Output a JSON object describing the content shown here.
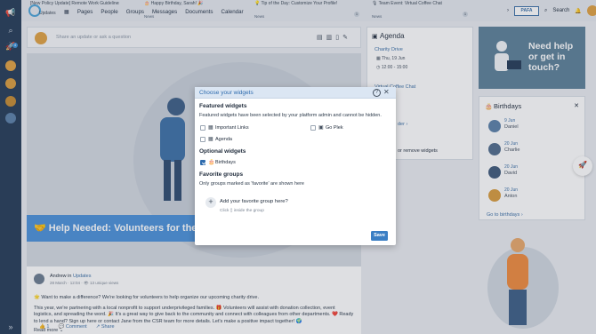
{
  "topbar": {
    "news": [
      {
        "title": "[New Policy Update] Remote Work Guidelines",
        "tag": "Updates",
        "count": ""
      },
      {
        "title": "🎂 Happy Birthday, Sarah! 🎉",
        "tag": "News",
        "count": "1"
      },
      {
        "title": "💡 Tip of the Day: Customize Your Profile!",
        "tag": "News",
        "count": "1"
      },
      {
        "title": "🎙 Team Event: Virtual Coffee Chat",
        "tag": "News",
        "count": "1"
      }
    ],
    "nav": [
      "Pages",
      "People",
      "Groups",
      "Messages",
      "Documents",
      "Calendar"
    ],
    "brand_short": "Updates",
    "search_label": "Search",
    "pill_logo": "PAFA"
  },
  "composer": {
    "placeholder": "Share an update or ask a question"
  },
  "post": {
    "hero_title": "🤝 Help Needed: Volunteers for the C",
    "author_line": "Andrew in",
    "author_group": "Updates",
    "date_line": "28 March · 12:04 · 👁 13 unique views",
    "body": [
      "🌟 Want to make a difference? We're looking for volunteers to help organize our upcoming charity drive.",
      "This year, we're partnering with a local nonprofit to support underprivileged families. 🎁 Volunteers will assist with donation collection, event logistics, and spreading the word. 🎉 It's a great way to give back to the community and connect with colleagues from other departments. ❤️ Ready to lend a hand? Sign up here or contact Jane from the CSR team for more details. Let's make a positive impact together! 🌍"
    ],
    "read_more": "Read more",
    "like_count": "1",
    "comment_label": "Comment",
    "share_label": "Share"
  },
  "agenda": {
    "title": "Agenda",
    "items": [
      {
        "name": "Charity Drive",
        "date": "Thu, 19 Jun",
        "time": "12:00 - 15:00"
      },
      {
        "name": "Virtual Coffee Chat",
        "date": "",
        "time": ""
      }
    ],
    "reorder_fragment": "der",
    "remove_fragment": "or remove widgets"
  },
  "help": {
    "text": "Need help or get in touch?"
  },
  "birthdays": {
    "title": "Birthdays",
    "people": [
      {
        "date": "9 Jun",
        "name": "Daniel"
      },
      {
        "date": "20 Jun",
        "name": "Charlie"
      },
      {
        "date": "20 Jun",
        "name": "David"
      },
      {
        "date": "20 Jun",
        "name": "Anton"
      }
    ],
    "goto": "Go to birthdays"
  },
  "rail": {
    "badge": "4"
  },
  "modal": {
    "title": "Choose your widgets",
    "featured_heading": "Featured widgets",
    "featured_desc": "Featured widgets have been selected by your platform admin and cannot be hidden.",
    "featured": [
      {
        "label": "Important Links",
        "checked": false
      },
      {
        "label": "Go Plek",
        "checked": false
      },
      {
        "label": "Agenda",
        "checked": false
      }
    ],
    "optional_heading": "Optional widgets",
    "optional": [
      {
        "label": "Birthdays",
        "checked": true
      }
    ],
    "fav_heading": "Favorite groups",
    "fav_desc": "Only groups marked as 'favorite' are shown here",
    "fav_add": "Add your favorite group here?",
    "fav_hint_pre": "Click",
    "fav_hint_post": "inside the group",
    "save_label": "Save"
  },
  "colors": {
    "accent": "#2f6cae",
    "rail": "#233a56",
    "hero_band": "#4a90d9",
    "help_card": "#5b7f98"
  }
}
